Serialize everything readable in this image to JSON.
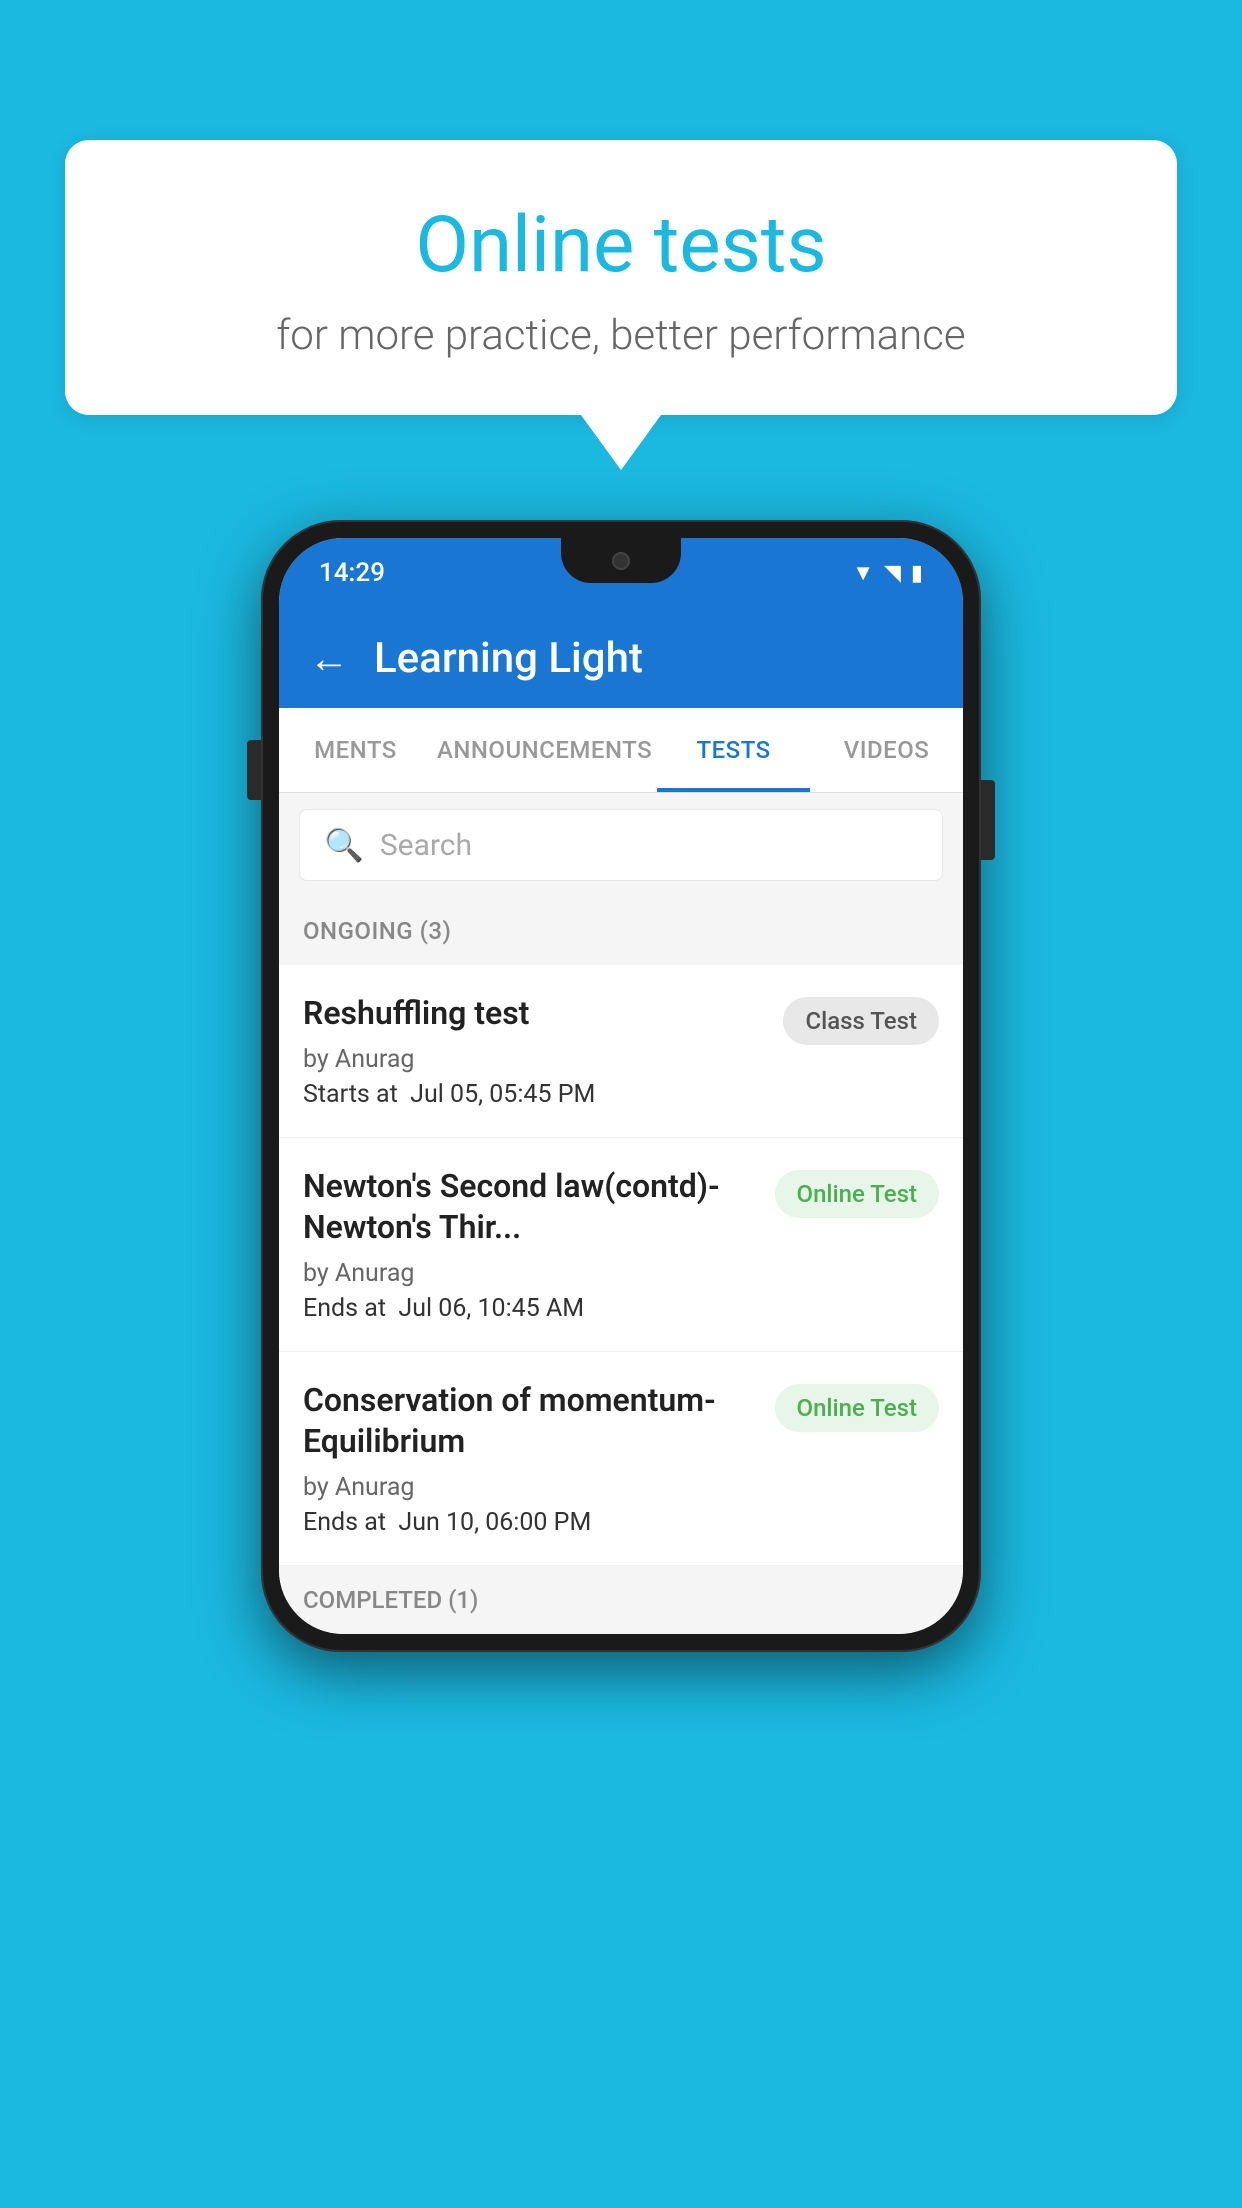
{
  "background": {
    "color": "#1BB8E0"
  },
  "speech_bubble": {
    "title": "Online tests",
    "subtitle": "for more practice, better performance"
  },
  "phone": {
    "status_bar": {
      "time": "14:29",
      "icons": [
        "wifi",
        "signal",
        "battery"
      ]
    },
    "app_bar": {
      "back_label": "←",
      "title": "Learning Light"
    },
    "tabs": [
      {
        "label": "MENTS",
        "active": false
      },
      {
        "label": "ANNOUNCEMENTS",
        "active": false
      },
      {
        "label": "TESTS",
        "active": true
      },
      {
        "label": "VIDEOS",
        "active": false
      }
    ],
    "search": {
      "placeholder": "Search"
    },
    "ongoing_section": {
      "header": "ONGOING (3)",
      "tests": [
        {
          "name": "Reshuffling test",
          "by": "by Anurag",
          "date_label": "Starts at",
          "date_value": "Jul 05, 05:45 PM",
          "badge": "Class Test",
          "badge_type": "class"
        },
        {
          "name": "Newton's Second law(contd)-Newton's Thir...",
          "by": "by Anurag",
          "date_label": "Ends at",
          "date_value": "Jul 06, 10:45 AM",
          "badge": "Online Test",
          "badge_type": "online"
        },
        {
          "name": "Conservation of momentum-Equilibrium",
          "by": "by Anurag",
          "date_label": "Ends at",
          "date_value": "Jun 10, 06:00 PM",
          "badge": "Online Test",
          "badge_type": "online"
        }
      ]
    },
    "completed_section": {
      "header": "COMPLETED (1)"
    }
  }
}
